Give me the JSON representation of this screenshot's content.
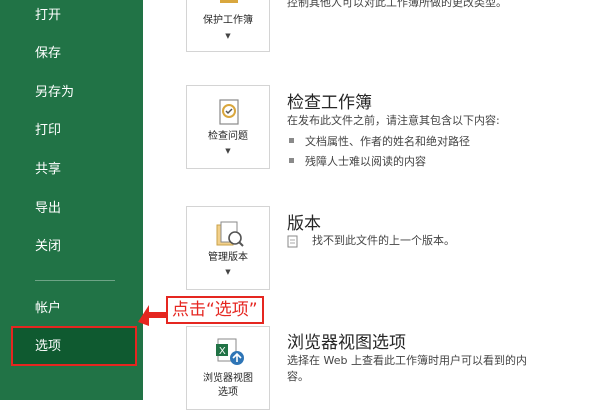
{
  "sidebar": {
    "items": [
      {
        "label": "打开"
      },
      {
        "label": "保存"
      },
      {
        "label": "另存为"
      },
      {
        "label": "打印"
      },
      {
        "label": "共享"
      },
      {
        "label": "导出"
      },
      {
        "label": "关闭"
      },
      {
        "label": "帐户"
      },
      {
        "label": "选项"
      }
    ],
    "selected": "选项"
  },
  "callout": {
    "text": "点击“选项”",
    "color": "#e52620"
  },
  "sections": {
    "protect": {
      "button_label": "保护工作簿",
      "desc": "控制其他人可以对此工作簿所做的更改类型。"
    },
    "inspect": {
      "title": "检查工作簿",
      "button_label": "检查问题",
      "desc": "在发布此文件之前，请注意其包含以下内容:",
      "bullets": [
        "文档属性、作者的姓名和绝对路径",
        "残障人士难以阅读的内容"
      ]
    },
    "versions": {
      "title": "版本",
      "button_label": "管理版本",
      "desc": "找不到此文件的上一个版本。"
    },
    "browser": {
      "title": "浏览器视图选项",
      "button_label_line1": "浏览器视图",
      "button_label_line2": "选项",
      "desc_line1": "选择在 Web 上查看此工作簿时用户可以看到的内",
      "desc_line2": "容。"
    }
  },
  "colors": {
    "sidebar": "#217346",
    "sidebar_selected": "#0f5a30",
    "accent": "#e52620"
  },
  "icons": [
    "lock-icon",
    "inspect-icon",
    "versions-icon",
    "browser-view-icon",
    "file-icon"
  ]
}
